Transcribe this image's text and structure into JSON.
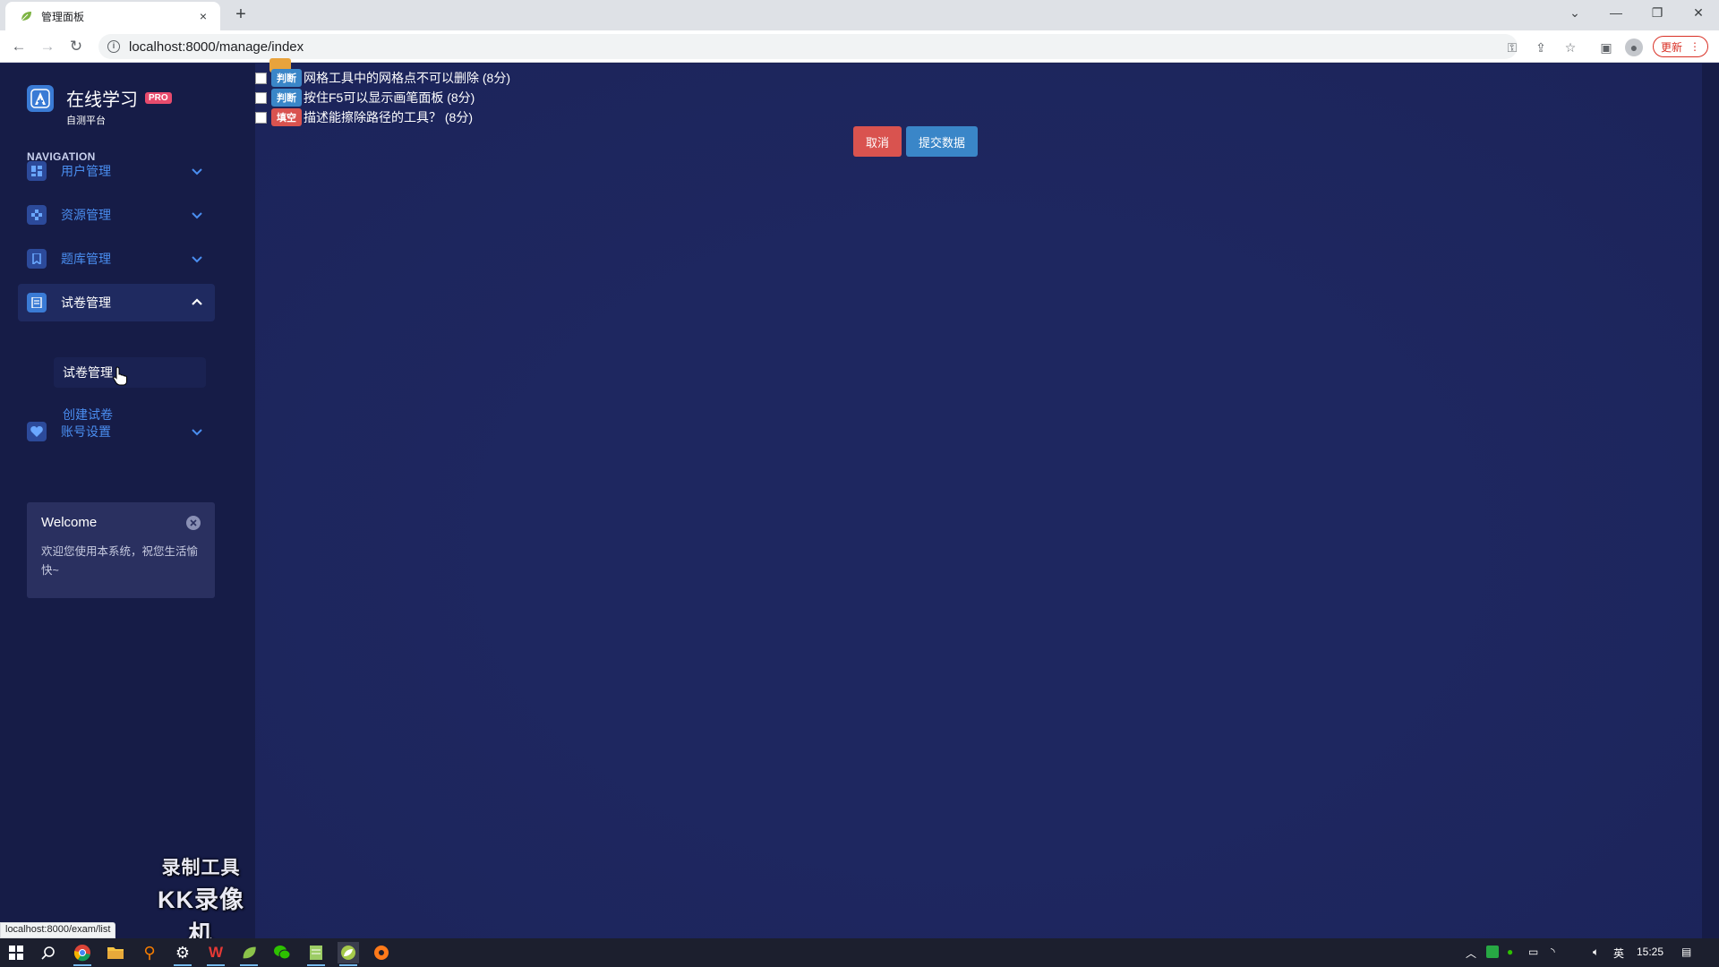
{
  "browser": {
    "tab_title": "管理面板",
    "tab_close": "×",
    "new_tab": "+",
    "url": "localhost:8000/manage/index",
    "update_label": "更新",
    "status_url": "localhost:8000/exam/list"
  },
  "brand": {
    "name": "在线学习",
    "badge": "PRO",
    "subtitle": "自测平台"
  },
  "sidebar": {
    "nav_title": "NAVIGATION",
    "items": [
      {
        "label": "用户管理",
        "icon": "dashboard-icon"
      },
      {
        "label": "资源管理",
        "icon": "puzzle-icon"
      },
      {
        "label": "题库管理",
        "icon": "bookmark-icon"
      },
      {
        "label": "试卷管理",
        "icon": "paper-icon"
      },
      {
        "label": "账号设置",
        "icon": "heart-icon"
      }
    ],
    "sub_items": [
      {
        "label": "试卷管理"
      },
      {
        "label": "创建试卷"
      }
    ]
  },
  "welcome": {
    "title": "Welcome",
    "body": "欢迎您使用本系统，祝您生活愉快~"
  },
  "watermark": {
    "line1": "录制工具",
    "line2": "KK录像机"
  },
  "questions": [
    {
      "tag": "判断",
      "text": "网格工具中的网格点不可以删除 (8分)"
    },
    {
      "tag": "判断",
      "text": "按住F5可以显示画笔面板 (8分)"
    },
    {
      "tag": "填空",
      "text": "描述能擦除路径的工具？ (8分)"
    }
  ],
  "actions": {
    "cancel": "取消",
    "submit": "提交数据"
  },
  "taskbar": {
    "ime": "英",
    "time": "15:25"
  },
  "colors": {
    "sidebar_bg": "#161c47",
    "main_bg": "#1e2760",
    "link_blue": "#4a8ef0",
    "danger": "#d9534f",
    "primary": "#3a86c8",
    "pro_badge": "#e84b6d"
  }
}
